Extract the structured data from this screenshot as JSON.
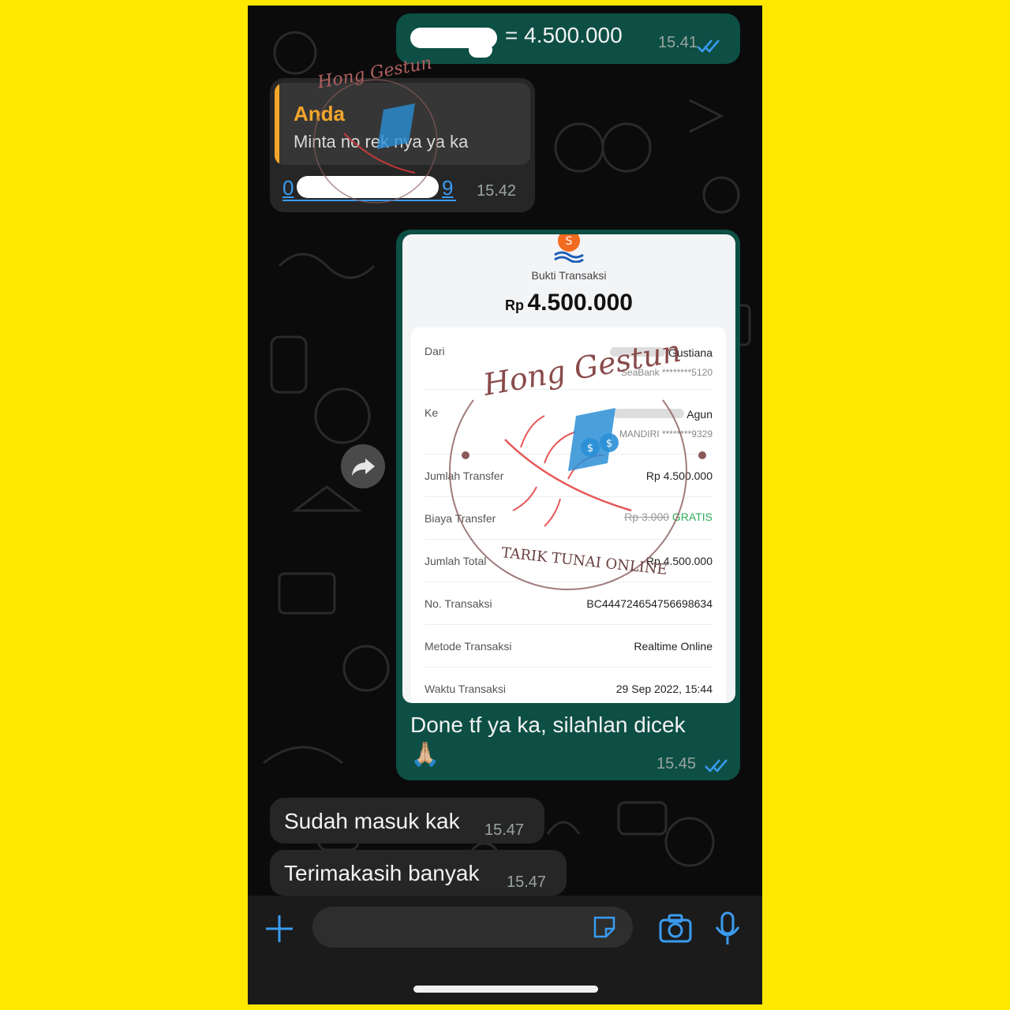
{
  "chat": {
    "messages": [
      {
        "text": "= 4.500.000",
        "time": "15.41"
      },
      {
        "quote_author": "Anda",
        "quote_text": "Minta no rek nya ya ka",
        "link_text": "0",
        "link_tail": "9",
        "time": "15.42"
      },
      {
        "caption": "Done tf ya ka, silahlan dicek",
        "emoji": "🙏🏼",
        "time": "15.45"
      },
      {
        "text": "Sudah masuk kak",
        "time": "15.47"
      },
      {
        "text": "Terimakasih banyak",
        "time": "15.47"
      }
    ]
  },
  "receipt": {
    "title": "Bukti Transaksi",
    "currency": "Rp",
    "amount": "4.500.000",
    "rows": [
      {
        "label": "Dari",
        "value": "Gustiana",
        "sub": "SeaBank ********5120"
      },
      {
        "label": "Ke",
        "value": "Agun",
        "sub": "MANDIRI ********9329"
      },
      {
        "label": "Jumlah Transfer",
        "value": "Rp 4.500.000"
      },
      {
        "label": "Biaya Transfer",
        "value_struck": "Rp 3.000",
        "value_free": "GRATIS"
      },
      {
        "label": "Jumlah Total",
        "value": "Rp 4.500.000"
      },
      {
        "label": "No. Transaksi",
        "value": "BC444724654756698634"
      },
      {
        "label": "Metode Transaksi",
        "value": "Realtime Online"
      },
      {
        "label": "Waktu Transaksi",
        "value": "29 Sep 2022, 15:44"
      }
    ]
  },
  "watermark": {
    "brand": "Hong Gestun",
    "tagline": "TARIK TUNAI ONLINE"
  },
  "icons": {
    "read_ticks": "double-check-icon",
    "forward": "forward-arrow-icon",
    "add": "plus-icon",
    "sticker": "sticker-icon",
    "camera": "camera-icon",
    "mic": "microphone-icon"
  },
  "colors": {
    "background": "#FFE800",
    "outgoing_bubble": "#0d4f44",
    "incoming_bubble": "#262626",
    "accent_blue": "#3a9cf0",
    "quote_bar": "#f4a62a",
    "free_green": "#2fae5b"
  }
}
